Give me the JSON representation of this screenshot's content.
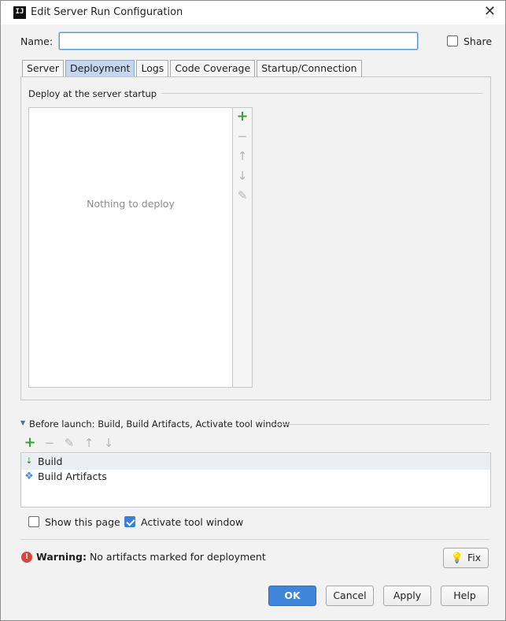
{
  "window": {
    "icon_text": "IJ",
    "title": "Edit Server Run Configuration",
    "close_symbol": "✕"
  },
  "name_field": {
    "label": "Name:",
    "value": ""
  },
  "share": {
    "label": "Share",
    "checked": false
  },
  "tabs": [
    {
      "label": "Server",
      "active": false
    },
    {
      "label": "Deployment",
      "active": true
    },
    {
      "label": "Logs",
      "active": false
    },
    {
      "label": "Code Coverage",
      "active": false
    },
    {
      "label": "Startup/Connection",
      "active": false
    }
  ],
  "deployment": {
    "section_title": "Deploy at the server startup",
    "empty_text": "Nothing to deploy",
    "toolbar": {
      "add_icon": "+",
      "remove_icon": "−",
      "up_icon": "↑",
      "down_icon": "↓",
      "edit_icon": "✎"
    }
  },
  "before_launch": {
    "expand_icon": "▼",
    "title": "Before launch: Build, Build Artifacts, Activate tool window",
    "toolbar": {
      "add_icon": "+",
      "remove_icon": "−",
      "edit_icon": "✎",
      "up_icon": "↑",
      "down_icon": "↓"
    },
    "items": [
      {
        "label": "Build",
        "icon": "build-icon",
        "icon_glyph": "⇣",
        "selected": true
      },
      {
        "label": "Build Artifacts",
        "icon": "artifacts-icon",
        "icon_glyph": "❖",
        "selected": false
      }
    ]
  },
  "options": {
    "show_this_page": {
      "label": "Show this page",
      "checked": false
    },
    "activate_tool_window": {
      "label": "Activate tool window",
      "checked": true
    }
  },
  "warning": {
    "icon_glyph": "!",
    "bold": "Warning:",
    "text": " No artifacts marked for deployment",
    "fix_label": "Fix",
    "fix_icon_glyph": "💡"
  },
  "buttons": {
    "ok": "OK",
    "cancel": "Cancel",
    "apply": "Apply",
    "help": "Help"
  },
  "colors": {
    "primary_button": "#3f85d9",
    "active_tab": "#c5d7ef",
    "checkbox_checked": "#3d7fd7",
    "add_icon": "#3aa03a",
    "warning_icon": "#d9453b"
  }
}
